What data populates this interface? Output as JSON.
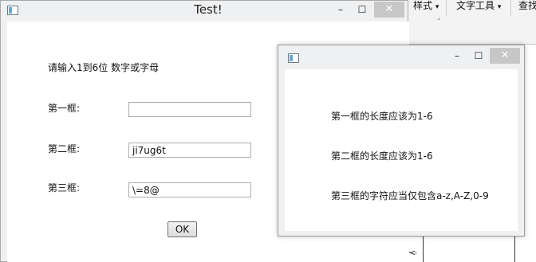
{
  "main_window": {
    "title": "Test!",
    "minimize_glyph": "–",
    "maximize_glyph": "☐",
    "close_glyph": "✕",
    "instruction": "请输入1到6位 数字或字母",
    "fields": [
      {
        "label": "第一框:",
        "value": ""
      },
      {
        "label": "第二框:",
        "value": "ji7ug6t"
      },
      {
        "label": "第三框:",
        "value": "\\=8@"
      }
    ],
    "ok_label": "OK"
  },
  "message_window": {
    "minimize_glyph": "–",
    "maximize_glyph": "☐",
    "close_glyph": "✕",
    "lines": [
      "第一框的长度应该为1-6",
      "第二框的长度应该为1-6",
      "第三框的字符应当仅包含a-z,A-Z,0-9"
    ]
  },
  "background_app": {
    "ribbon_items": [
      "样式",
      "文字工具",
      "查找"
    ],
    "dropdown_glyph": "▾",
    "launcher_glyph": "⌟",
    "vertical_char": "ÿ"
  },
  "colors": {
    "titlebar": "#eff0f2",
    "client": "#ffffff",
    "close_button": "#c7c7c7",
    "textbox_border": "#abadb3"
  },
  "icons": {
    "window_icon": "app-window-icon",
    "minimize": "minimize-icon",
    "maximize": "maximize-icon",
    "close": "close-icon"
  }
}
